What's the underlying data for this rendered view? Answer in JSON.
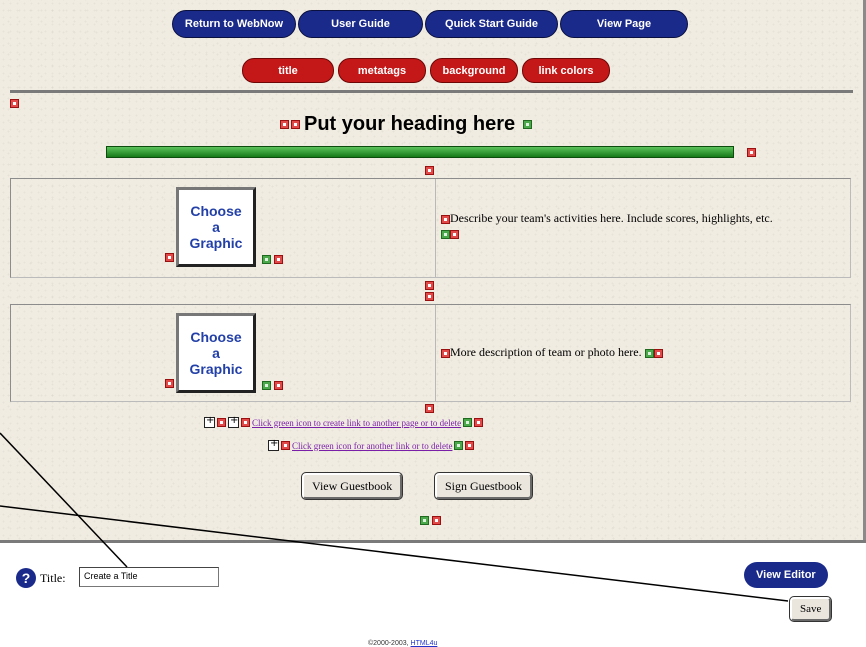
{
  "nav": {
    "buttons": [
      "Return to WebNow",
      "User Guide",
      "Quick Start Guide",
      "View Page"
    ],
    "sub_buttons": [
      "title",
      "metatags",
      "background",
      "link colors"
    ]
  },
  "content": {
    "heading": "Put your heading here",
    "graphic_text": [
      "Choose",
      "a",
      "Graphic"
    ],
    "desc1": "Describe your team's activities here. Include scores, highlights, etc.",
    "desc2": "More description of team or photo here.",
    "link1": "Click green icon to create link to another page or to delete",
    "link2": "Click green icon for another link or to delete",
    "guestbook_buttons": [
      "View Guestbook",
      "Sign Guestbook"
    ]
  },
  "footer": {
    "title_label": "Title:",
    "title_value": "Create a Title",
    "view_editor": "View Editor",
    "save": "Save",
    "copyright": "©2000-2003,",
    "copyright_link": "HTML4u"
  },
  "colors": {
    "nav_blue": "#1a2a8a",
    "tab_red": "#c41818",
    "rule_green": "#167a16",
    "link_purple": "#7a1fa8"
  }
}
